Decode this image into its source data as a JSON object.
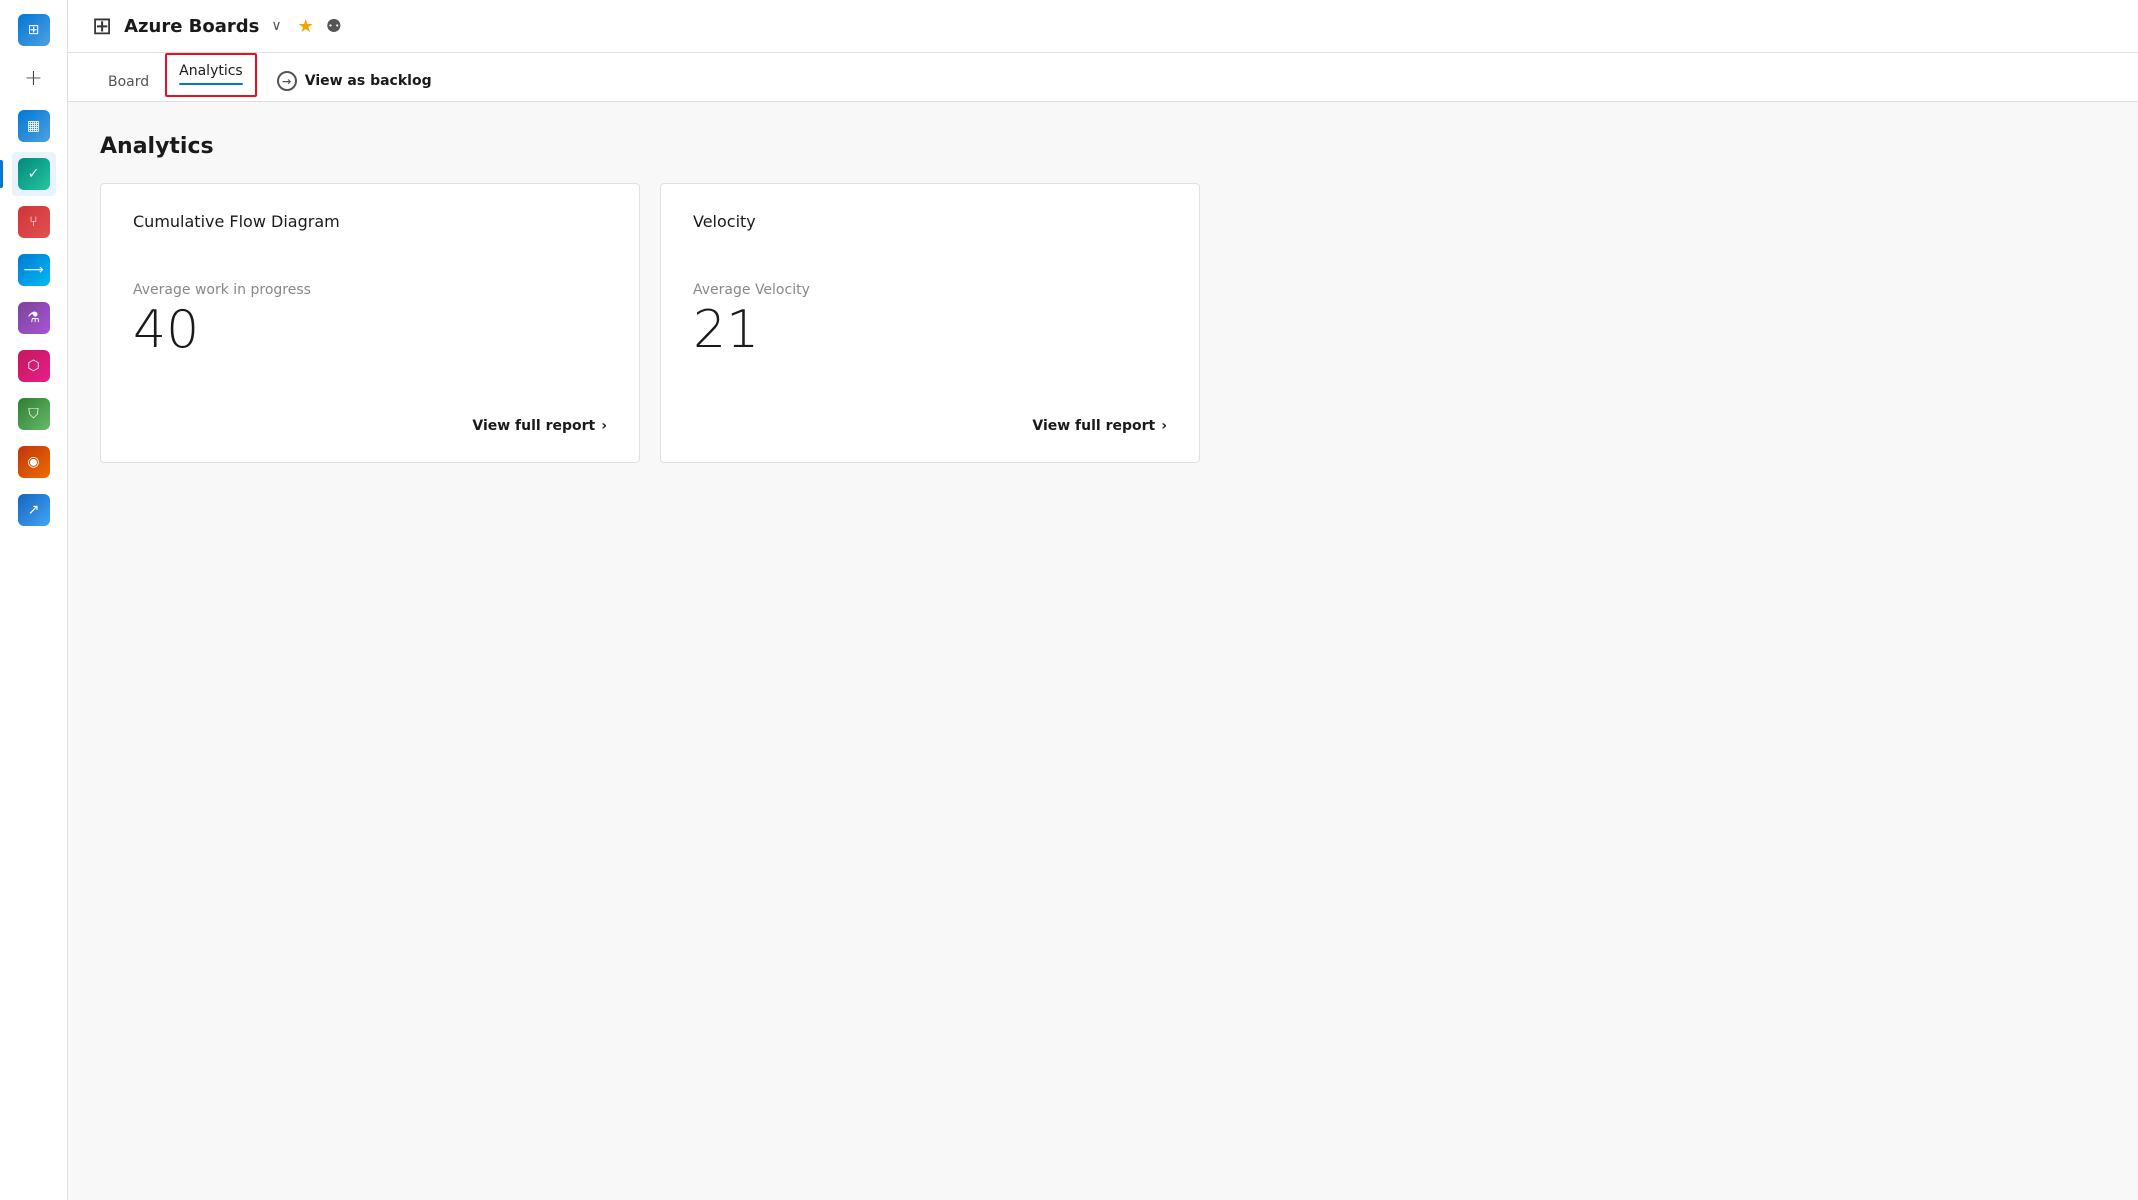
{
  "sidebar": {
    "icons": [
      {
        "name": "azure-devops-icon",
        "symbol": "⊞",
        "active": false
      },
      {
        "name": "plus-icon",
        "symbol": "+",
        "active": false
      },
      {
        "name": "boards-icon",
        "symbol": "▦",
        "active": false
      },
      {
        "name": "kanban-icon",
        "symbol": "✓",
        "active": true
      },
      {
        "name": "repos-icon",
        "symbol": "⑂",
        "active": false
      },
      {
        "name": "pipelines-icon",
        "symbol": "⟶",
        "active": false
      },
      {
        "name": "test-icon",
        "symbol": "⚗",
        "active": false
      },
      {
        "name": "artifacts-icon",
        "symbol": "⬡",
        "active": false
      },
      {
        "name": "security-icon",
        "symbol": "⛉",
        "active": false
      },
      {
        "name": "feedback-icon",
        "symbol": "◉",
        "active": false
      },
      {
        "name": "analytics-icon",
        "symbol": "↗",
        "active": false
      }
    ]
  },
  "header": {
    "icon_symbol": "⊞",
    "title": "Azure Boards",
    "chevron": "∨",
    "star_symbol": "★",
    "person_symbol": "⚉"
  },
  "nav": {
    "board_label": "Board",
    "analytics_label": "Analytics",
    "view_backlog_label": "View as backlog",
    "view_backlog_icon": "→"
  },
  "page": {
    "title": "Analytics",
    "cards": [
      {
        "id": "cumulative-flow",
        "title": "Cumulative Flow Diagram",
        "stat_label": "Average work in progress",
        "stat_value": "40",
        "footer_label": "View full report"
      },
      {
        "id": "velocity",
        "title": "Velocity",
        "stat_label": "Average Velocity",
        "stat_value": "21",
        "footer_label": "View full report"
      }
    ]
  },
  "colors": {
    "active_tab_underline": "#0078d4",
    "red_border": "#e81123",
    "accent": "#0078d4"
  }
}
